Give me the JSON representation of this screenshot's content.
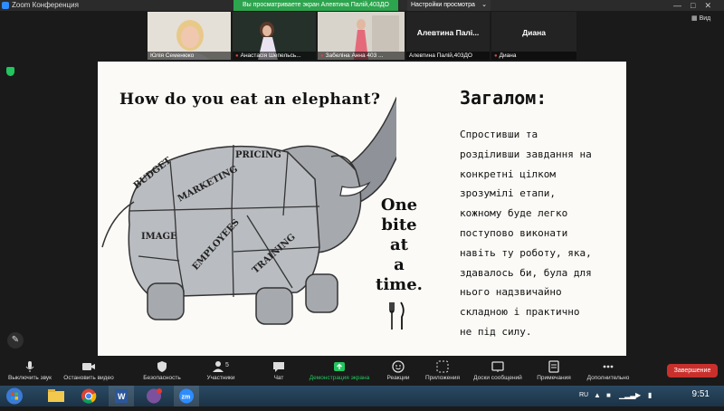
{
  "window": {
    "title": "Zoom Конференция"
  },
  "banner": {
    "sharing_text": "Вы просматриваете экран Алевтина Палій,403ДО"
  },
  "view_options": {
    "label": "Настройки просмотра"
  },
  "view_button": {
    "label": "Вид"
  },
  "participants": [
    {
      "name": "Юлія Семенюко",
      "muted": false
    },
    {
      "name": "Анастасія Шепельсь...",
      "muted": true
    },
    {
      "name": "Забеліна  Анна 403 ...",
      "muted": true
    },
    {
      "name": "Алевтина Палій,403ДО",
      "display": "Алевтина  Палі...",
      "muted": false
    },
    {
      "name": "Диана",
      "display": "Диана",
      "muted": true
    }
  ],
  "slide": {
    "title": "How do you eat an elephant?",
    "sections": [
      "BUDGET",
      "MARKETING",
      "PRICING",
      "IMAGE",
      "EMPLOYEES",
      "TRAINING"
    ],
    "bite_words": [
      "One",
      "bite",
      "at",
      "a",
      "time."
    ],
    "summary_title": "Загалом:",
    "summary_lines": [
      "Спростивши та",
      "розділивши завдання на",
      "конкретні цілком",
      "зрозумілі етапи,",
      "кожному буде легко",
      "поступово виконати",
      "навіть ту роботу, яка,",
      "здавалось би, була для",
      "нього надзвичайно",
      "складною і практично",
      "не під силу."
    ]
  },
  "toolbar": {
    "items": [
      {
        "label": "Выключить звук",
        "icon": "microphone-icon"
      },
      {
        "label": "Остановить видео",
        "icon": "video-camera-icon"
      },
      {
        "label": "Безопасность",
        "icon": "shield-icon"
      },
      {
        "label": "Участники",
        "icon": "participants-icon",
        "count": "5"
      },
      {
        "label": "Чат",
        "icon": "chat-icon"
      },
      {
        "label": "Демонстрация экрана",
        "icon": "share-screen-icon"
      },
      {
        "label": "Реакции",
        "icon": "reactions-icon"
      },
      {
        "label": "Приложения",
        "icon": "apps-icon"
      },
      {
        "label": "Доски сообщений",
        "icon": "whiteboard-icon"
      },
      {
        "label": "Примечания",
        "icon": "notes-icon"
      },
      {
        "label": "Дополнительно",
        "icon": "more-icon"
      }
    ],
    "end_label": "Завершение",
    "share_color": "#22c55e"
  },
  "taskbar": {
    "language": "RU",
    "time": "9:51",
    "apps": [
      "start-button",
      "file-explorer-icon",
      "chrome-icon",
      "word-icon",
      "viber-icon",
      "zoom-icon"
    ]
  }
}
